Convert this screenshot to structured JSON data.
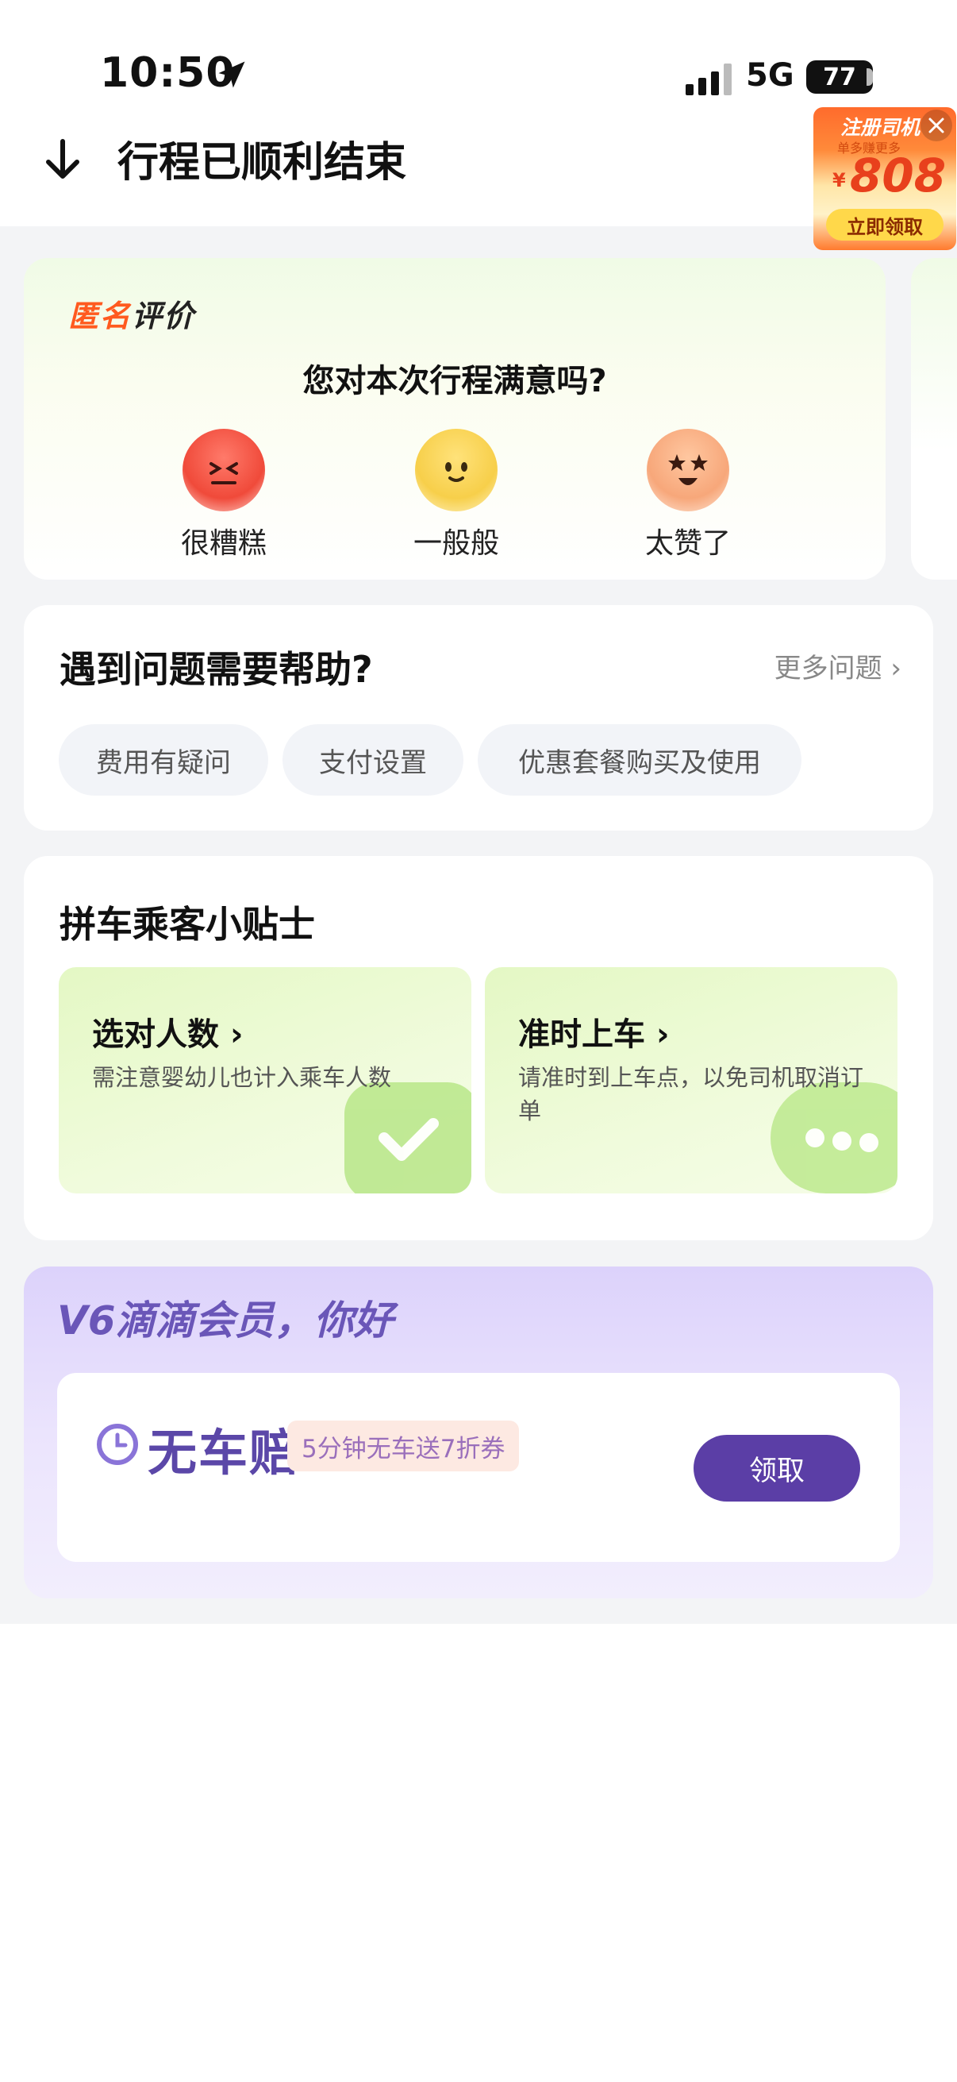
{
  "status_bar": {
    "time": "10:50",
    "network": "5G",
    "battery": "77"
  },
  "header": {
    "title": "行程已顺利结束",
    "back_icon": "arrow-down-icon"
  },
  "promo": {
    "title": "注册司机",
    "subtitle": "单多赚更多",
    "currency": "¥",
    "amount": "808",
    "button": "立即领取"
  },
  "rating": {
    "badge_part1": "匿名",
    "badge_part2": "评价",
    "question": "您对本次行程满意吗?",
    "options": [
      {
        "label": "很糟糕",
        "icon": "angry-face-icon"
      },
      {
        "label": "一般般",
        "icon": "neutral-face-icon"
      },
      {
        "label": "太赞了",
        "icon": "star-eyes-face-icon"
      }
    ]
  },
  "help": {
    "title": "遇到问题需要帮助?",
    "more": "更多问题",
    "chips": [
      "费用有疑问",
      "支付设置",
      "优惠套餐购买及使用"
    ]
  },
  "tips": {
    "title": "拼车乘客小贴士",
    "items": [
      {
        "title": "选对人数",
        "desc": "需注意婴幼儿也计入乘车人数"
      },
      {
        "title": "准时上车",
        "desc": "请准时到上车点，以免司机取消订单"
      }
    ]
  },
  "member": {
    "title": "V6滴滴会员，你好",
    "product_name": "无车赔",
    "product_badge": "5分钟无车送7折券",
    "claim_button": "领取"
  },
  "colors": {
    "accent_orange": "#ff5a1f",
    "member_purple": "#5b3ea6",
    "tip_green": "#e4f8c4"
  }
}
